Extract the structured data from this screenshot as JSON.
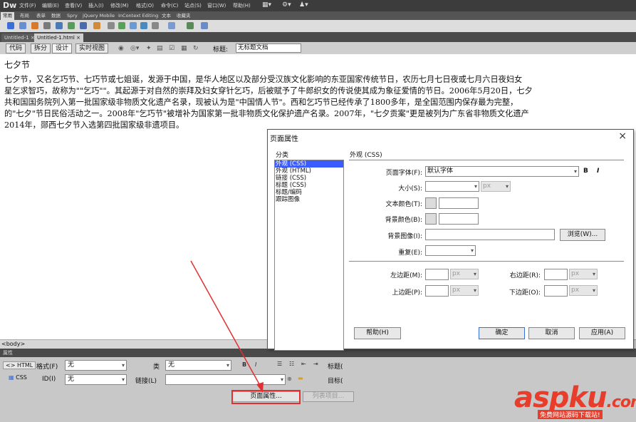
{
  "app": {
    "logo": "Dw"
  },
  "menu": [
    "文件(F)",
    "编辑(E)",
    "查看(V)",
    "插入(I)",
    "修改(M)",
    "格式(O)",
    "命令(C)",
    "站点(S)",
    "窗口(W)",
    "帮助(H)"
  ],
  "insert_tabs": [
    "常用",
    "布局",
    "表单",
    "数据",
    "Spry",
    "jQuery Mobile",
    "InContext Editing",
    "文本",
    "收藏夹"
  ],
  "doc_tabs": [
    "Untitled-1",
    "Untitled-1.html"
  ],
  "view_bar": {
    "buttons": [
      "代码",
      "拆分",
      "设计",
      "实时视图"
    ],
    "title_label": "标题:",
    "title_value": "无标题文档"
  },
  "document": {
    "heading": "七夕节",
    "lines": [
      "七夕节，又名乞巧节、七巧节或七姐诞，发源于中国，是华人地区以及部分受汉族文化影响的东亚国家传统节日，农历七月七日夜或七月六日夜妇女",
      "星乞求智巧，故称为\"\"乞巧\"\"。其起源于对自然的崇拜及妇女穿针乞巧，后被赋予了牛郎织女的传说使其成为象征爱情的节日。2006年5月20日，七夕",
      "共和国国务院列入第一批国家级非物质文化遗产名录，现被认为是\"中国情人节\"。西和乞巧节已经传承了1800多年，是全国范围内保存最为完整，",
      "的\"七夕\"节日民俗活动之一。2008年\"乞巧节\"被增补为国家第一批非物质文化保护遗产名录。2007年，\"七夕贡案\"更是被列为广东省非物质文化遗产",
      "2014年，郧西七夕节入选第四批国家级非遗项目。"
    ]
  },
  "tag_bar": {
    "text": "<body>"
  },
  "properties": {
    "header": "属性",
    "html_tab": "<> HTML",
    "css_tab": "CSS",
    "format_label": "格式(F)",
    "format_value": "无",
    "class_label": "类",
    "class_value": "无",
    "id_label": "ID(I)",
    "id_value": "无",
    "link_label": "链接(L)",
    "title_label": "标题(",
    "target_label": "目标(",
    "page_props_button": "页面属性...",
    "list_item_button": "列表项目..."
  },
  "dialog": {
    "title": "页面属性",
    "category_label": "分类",
    "categories": [
      "外观 (CSS)",
      "外观 (HTML)",
      "链接 (CSS)",
      "标题 (CSS)",
      "标题/编码",
      "跟踪图像"
    ],
    "selected_category": 0,
    "section_title": "外观 (CSS)",
    "page_font_label": "页面字体(F):",
    "page_font_value": "默认字体",
    "bold": "B",
    "italic": "I",
    "size_label": "大小(S):",
    "size_unit": "px",
    "text_color_label": "文本颜色(T):",
    "bg_color_label": "背景颜色(B):",
    "bg_image_label": "背景图像(I):",
    "browse_button": "浏览(W)...",
    "repeat_label": "重复(E):",
    "left_margin_label": "左边距(M):",
    "right_margin_label": "右边距(R):",
    "top_margin_label": "上边距(P):",
    "bottom_margin_label": "下边距(O):",
    "margin_unit": "px",
    "help_button": "帮助(H)",
    "ok_button": "确定",
    "cancel_button": "取消",
    "apply_button": "应用(A)"
  },
  "watermark": {
    "brand": "aspku",
    "tld": ".com",
    "sub": "免费网站源码下载站!"
  },
  "colors": {
    "annotation": "#e03030",
    "selection": "#3a5cff",
    "watermark": "#e83d2a"
  }
}
